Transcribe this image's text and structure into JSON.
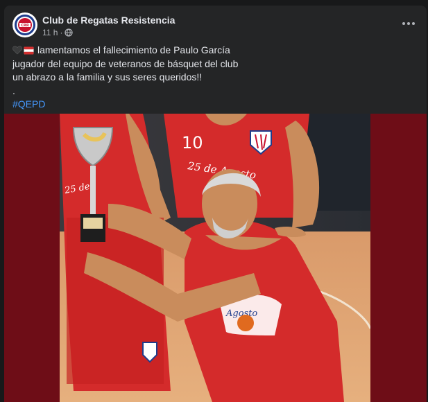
{
  "post": {
    "author": "Club de Regatas Resistencia",
    "timestamp": "11 h",
    "separator": "·",
    "privacy_icon": "globe-icon",
    "lines": [
      "lamentamos el fallecimiento de Paulo García",
      "jugador del equipo de veteranos de básquet del club",
      "un abrazo a la familia y sus seres queridos!!",
      "."
    ],
    "hashtag": "#QEPD",
    "emoji_icons": [
      "black-heart-icon",
      "red-white-flag-icon"
    ]
  },
  "photo": {
    "jersey_number": "10",
    "jersey_text": "25 de Agosto",
    "jersey_text_partial_1": "25 de",
    "jersey_text_partial_2": "Agosto"
  },
  "colors": {
    "background": "#18191a",
    "card": "#242526",
    "text": "#e4e6eb",
    "secondary_text": "#b0b3b8",
    "link": "#4599ff",
    "photo_border": "#6e0d17",
    "jersey_red": "#d42b2b"
  }
}
